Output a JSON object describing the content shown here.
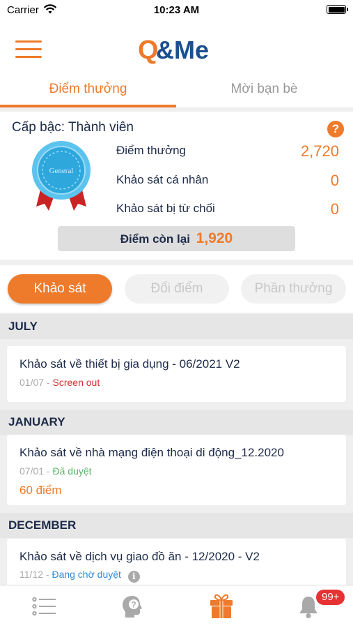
{
  "status_bar": {
    "carrier": "Carrier",
    "time": "10:23 AM"
  },
  "header": {
    "logo_text": "Q&Me",
    "menu_icon": "hamburger-icon"
  },
  "top_tabs": [
    {
      "label": "Điểm thưởng",
      "active": true
    },
    {
      "label": "Mời bạn bè",
      "active": false
    }
  ],
  "rank": {
    "title": "Cấp bậc: Thành viên",
    "badge_text": "General",
    "stats": [
      {
        "label": "Điểm thưởng",
        "value": "2,720"
      },
      {
        "label": "Khảo sát cá nhân",
        "value": "0"
      },
      {
        "label": "Khảo sát bị từ chối",
        "value": "0"
      }
    ],
    "remaining_label": "Điểm còn lại",
    "remaining_value": "1,920"
  },
  "segments": [
    {
      "label": "Khảo sát",
      "active": true
    },
    {
      "label": "Đổi điểm",
      "active": false
    },
    {
      "label": "Phần thưởng",
      "active": false
    }
  ],
  "sections": [
    {
      "month": "JULY",
      "items": [
        {
          "title": "Khảo sát về thiết bị gia dụng - 06/2021 V2",
          "date": "01/07",
          "status": "Screen out",
          "points": ""
        }
      ]
    },
    {
      "month": "JANUARY",
      "items": [
        {
          "title": "Khảo sát về nhà mạng điện thoại di động_12.2020",
          "date": "07/01",
          "status": "Đã duyệt",
          "points": "60 điểm"
        }
      ]
    },
    {
      "month": "DECEMBER",
      "items": [
        {
          "title": "Khảo sát về dịch vụ giao đồ ăn - 12/2020 - V2",
          "date": "11/12",
          "status": "Đang chờ duyệt",
          "points": ""
        }
      ]
    }
  ],
  "bottom_nav": {
    "items": [
      "list-icon",
      "help-head-icon",
      "gift-icon",
      "bell-icon"
    ],
    "active_index": 2,
    "notification_badge": "99+"
  },
  "colors": {
    "accent": "#ee7a2b",
    "navy": "#1c2a48",
    "logo_blue": "#1b4f8f"
  }
}
